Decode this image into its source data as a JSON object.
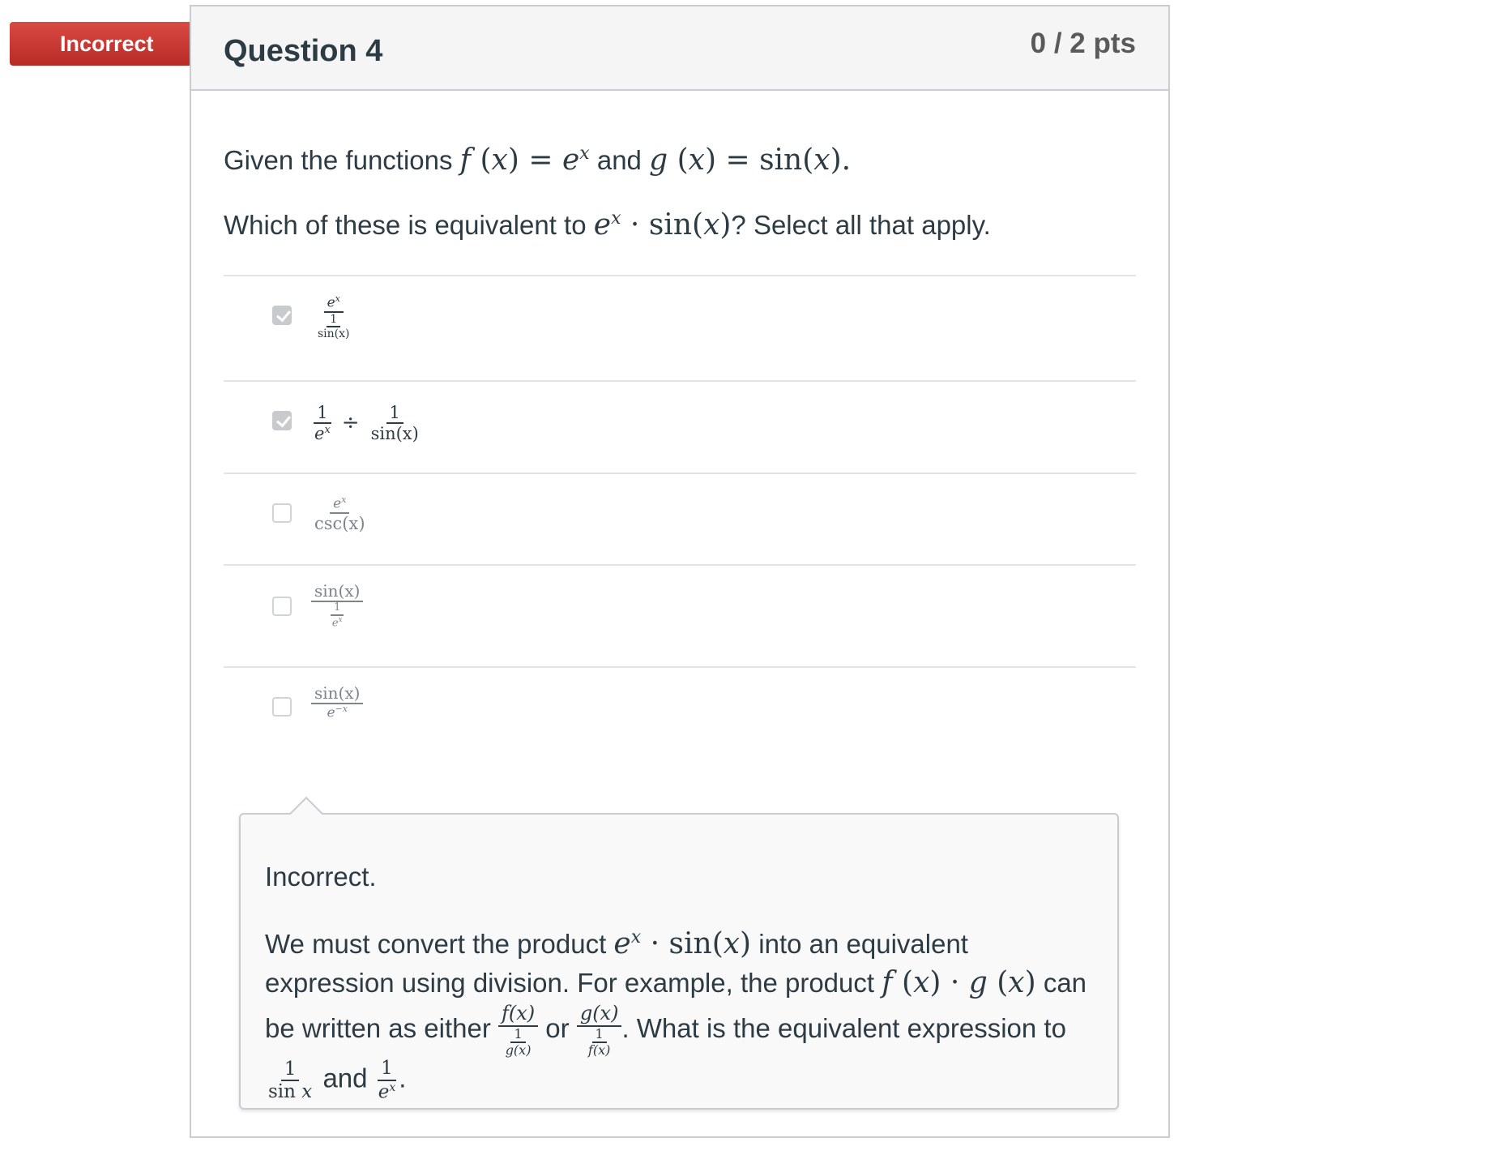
{
  "status_banner": {
    "label": "Incorrect",
    "color": "#c8322c"
  },
  "question": {
    "title": "Question 4",
    "points": "0 / 2 pts",
    "line1": {
      "prefix": "Given the functions ",
      "f": "f",
      "x": "x",
      "eq": "=",
      "e": "e",
      "and": " and ",
      "g": "g",
      "sin": "sin",
      "period": "."
    },
    "line2": {
      "prefix": "Which of these is equivalent to ",
      "suffix": "? Select all that apply."
    }
  },
  "answers": [
    {
      "checked": true,
      "num": "e",
      "num_sup": "x",
      "inner_num": "1",
      "inner_den": "sin(x)"
    },
    {
      "checked": true,
      "left_num": "1",
      "left_den": "e",
      "left_sup": "x",
      "op": "÷",
      "right_num": "1",
      "right_den": "sin(x)"
    },
    {
      "checked": false,
      "num": "e",
      "num_sup": "x",
      "den": "csc(x)"
    },
    {
      "checked": false,
      "num": "sin(x)",
      "inner_num": "1",
      "inner_den": "e",
      "inner_sup": "x"
    },
    {
      "checked": false,
      "num": "sin(x)",
      "den": "e",
      "den_sup": "−x"
    }
  ],
  "feedback": {
    "title": "Incorrect.",
    "p1": "We must convert the product ",
    "p2": " into an equivalent expression using division. For example, the product ",
    "p3": " can be written as either ",
    "or": " or ",
    "p4": ". What is the equivalent expression to ",
    "and": " and ",
    "end": "."
  }
}
